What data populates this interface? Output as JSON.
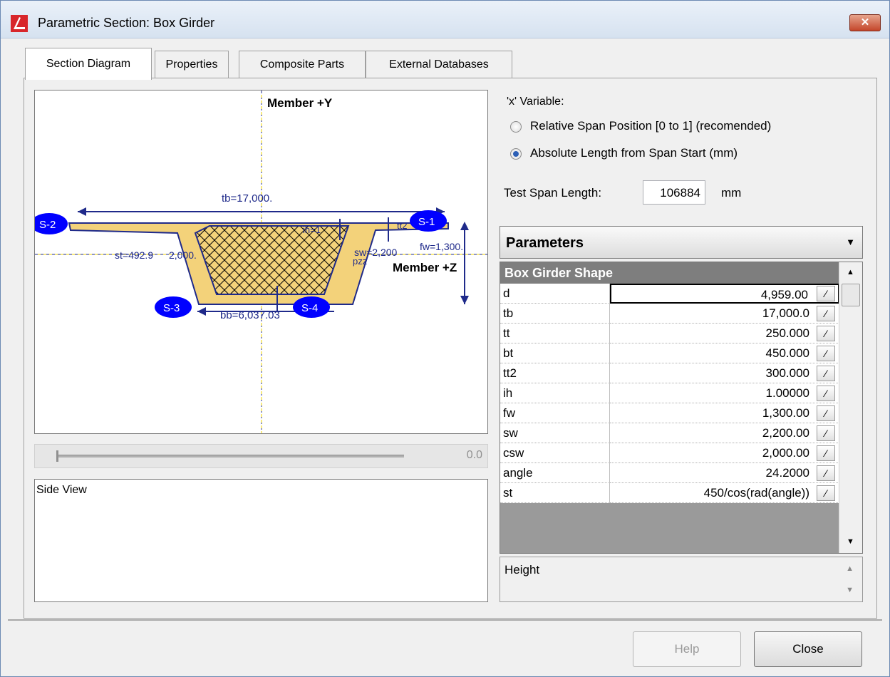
{
  "window": {
    "title": "Parametric Section: Box Girder",
    "close_glyph": "✕"
  },
  "tabs": [
    {
      "label": "Section Diagram",
      "active": true
    },
    {
      "label": "Properties",
      "active": false
    },
    {
      "label": "Composite Parts",
      "active": false
    },
    {
      "label": "External Databases",
      "active": false
    }
  ],
  "diagram": {
    "axis_y_label": "Member +Y",
    "axis_z_label": "Member +Z",
    "nodes": [
      "S-1",
      "S-2",
      "S-3",
      "S-4"
    ],
    "dims": {
      "tb": "tb=17,000.",
      "bb": "bb=6,037.03",
      "st": "st=492.9",
      "sw": "sw=2,200",
      "fw": "fw=1,300.",
      "ih": "ih=1",
      "tt2": "tt2",
      "pzz": "pzz",
      "csw": "2,000."
    }
  },
  "slider": {
    "value": "0.0"
  },
  "side_view": {
    "label": "Side View"
  },
  "x_variable": {
    "label": "'x' Variable:",
    "options": [
      {
        "label": "Relative Span Position [0 to 1] (recomended)",
        "selected": false
      },
      {
        "label": "Absolute Length from Span Start (mm)",
        "selected": true
      }
    ]
  },
  "test_span": {
    "label": "Test Span Length:",
    "value": "106884",
    "unit": "mm"
  },
  "parameters": {
    "dropdown_label": "Parameters",
    "group_title": "Box Girder Shape",
    "rows": [
      {
        "name": "d",
        "value": "4,959.00"
      },
      {
        "name": "tb",
        "value": "17,000.0"
      },
      {
        "name": "tt",
        "value": "250.000"
      },
      {
        "name": "bt",
        "value": "450.000"
      },
      {
        "name": "tt2",
        "value": "300.000"
      },
      {
        "name": "ih",
        "value": "1.00000"
      },
      {
        "name": "fw",
        "value": "1,300.00"
      },
      {
        "name": "sw",
        "value": "2,200.00"
      },
      {
        "name": "csw",
        "value": "2,000.00"
      },
      {
        "name": "angle",
        "value": "24.2000"
      },
      {
        "name": "st",
        "value": "450/cos(rad(angle))"
      }
    ],
    "edit_glyph": "⁄",
    "description": "Height"
  },
  "buttons": {
    "help": "Help",
    "close": "Close"
  }
}
